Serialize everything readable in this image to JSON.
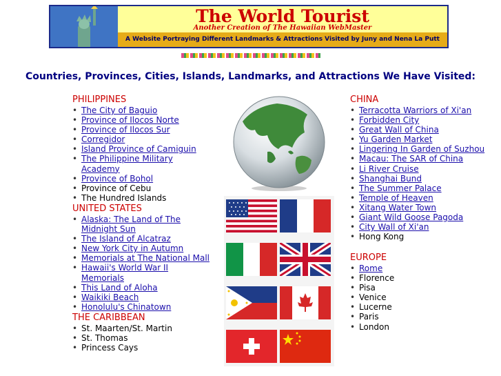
{
  "banner": {
    "title": "The World Tourist",
    "subtitle": "Another Creation of The Hawaiian WebMaster",
    "tagline": "A Website Portraying Different Landmarks & Attractions Visited by Juny and Nena La Putt"
  },
  "heading": "Countries, Provinces, Cities, Islands, Landmarks, and Attractions We Have Visited:",
  "philippines": {
    "title": "PHILIPPINES",
    "items": [
      " The City of Baguio",
      " Province of Ilocos Norte",
      " Province of Ilocos Sur",
      " Corregidor",
      " Island Province of Camiguin",
      "The Philippine Military Academy",
      " Province of Bohol",
      "Province of Cebu",
      "The Hundred Islands"
    ]
  },
  "united_states": {
    "title": "UNITED STATES",
    "items": [
      " Alaska: The Land of The Midnight Sun",
      " The Island of Alcatraz",
      " New York City in Autumn",
      " Memorials at The National Mall",
      " Hawaii's World War II Memorials",
      " This Land of Aloha",
      " Waikiki Beach",
      " Honolulu's Chinatown"
    ]
  },
  "caribbean": {
    "title": "THE CARIBBEAN",
    "items": [
      "St. Maarten/St. Martin",
      "St. Thomas",
      "Princess Cays"
    ]
  },
  "china": {
    "title": "CHINA",
    "items": [
      "Terracotta Warriors of Xi'an",
      "Forbidden City",
      "Great Wall of China",
      "Yu Garden Market",
      "Lingering In Garden of Suzhou",
      "Macau: The SAR of China",
      "Li River Cruise",
      "Shanghai Bund",
      "The Summer Palace",
      "Temple of Heaven",
      "Xitang Water Town",
      "Giant Wild Goose Pagoda",
      "City Wall of Xi'an",
      " Hong Kong"
    ]
  },
  "europe": {
    "title": "EUROPE",
    "items": [
      " Rome",
      "Florence",
      "Pisa",
      "Venice",
      "Lucerne",
      "Paris",
      "London"
    ]
  },
  "colors": {
    "title_red": "#cc0000",
    "heading_navy": "#000080",
    "link_blue": "#1a0dab",
    "banner_yellow": "#ffff99",
    "banner_gold": "#e6ab18"
  }
}
